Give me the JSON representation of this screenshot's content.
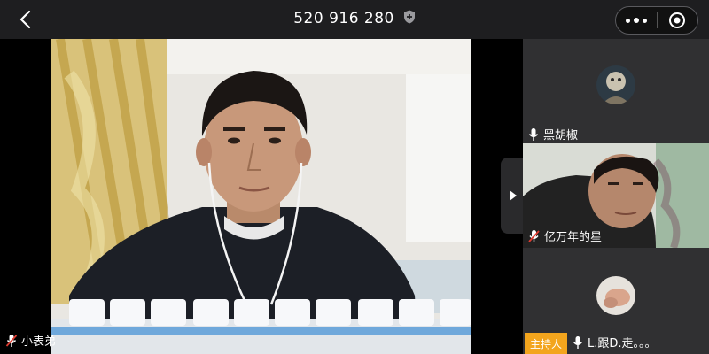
{
  "header": {
    "meeting_id": "520 916 280",
    "back_icon": "chevron-left-icon",
    "shield_icon": "shield-plus-icon",
    "more_icon": "more-dots-icon",
    "close_icon": "target-circle-icon"
  },
  "main": {
    "participant_name": "小表弟",
    "mic_state": "muted"
  },
  "side": {
    "participants": [
      {
        "name": "黑胡椒",
        "mic_state": "on",
        "video": "avatar"
      },
      {
        "name": "亿万年的星",
        "mic_state": "muted",
        "video": "camera"
      },
      {
        "name": "L.跟D.走。。。",
        "mic_state": "on",
        "video": "avatar",
        "role": "主持人"
      }
    ],
    "collapse_icon": "triangle-right-icon"
  },
  "colors": {
    "background": "#1c1c1e",
    "host_badge": "#f3a51d",
    "muted_slash": "#e03c31"
  }
}
